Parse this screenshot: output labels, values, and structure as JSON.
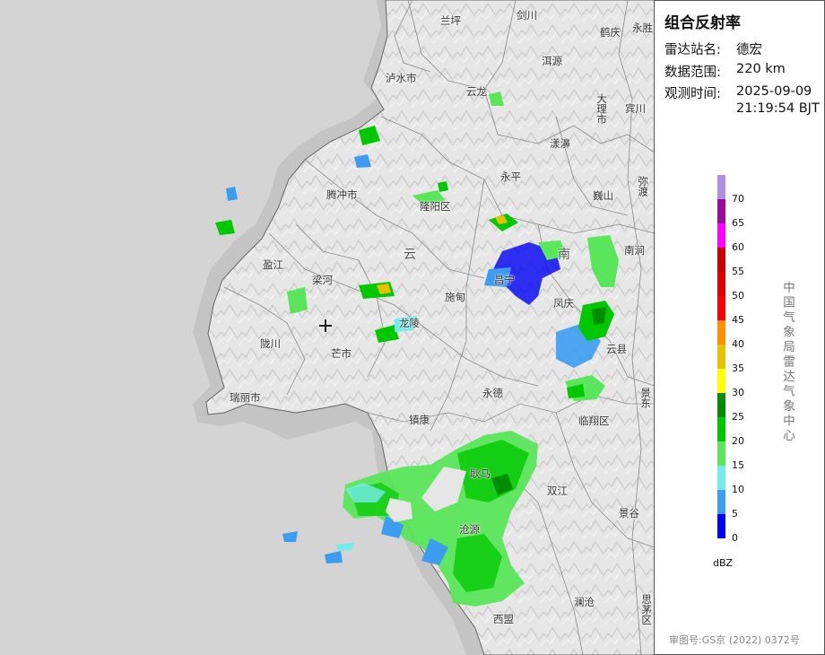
{
  "panel": {
    "title": "组合反射率",
    "station_label": "雷达站名:",
    "station_value": "德宏",
    "range_label": "数据范围:",
    "range_value": "220 km",
    "time_label": "观测时间:",
    "time_date": "2025-09-09",
    "time_clock": "21:19:54 BJT"
  },
  "legend": {
    "unit": "dBZ",
    "levels": [
      {
        "value": "70",
        "color": "#b18ee6"
      },
      {
        "value": "65",
        "color": "#9b0a9b"
      },
      {
        "value": "60",
        "color": "#ff00ff"
      },
      {
        "value": "55",
        "color": "#c80000"
      },
      {
        "value": "50",
        "color": "#e10000"
      },
      {
        "value": "45",
        "color": "#ff0000"
      },
      {
        "value": "40",
        "color": "#ff9000"
      },
      {
        "value": "35",
        "color": "#e7c000"
      },
      {
        "value": "30",
        "color": "#ffff00"
      },
      {
        "value": "25",
        "color": "#008e00"
      },
      {
        "value": "20",
        "color": "#00c800"
      },
      {
        "value": "15",
        "color": "#5ae65a"
      },
      {
        "value": "10",
        "color": "#74ecec"
      },
      {
        "value": "5",
        "color": "#3c9cf0"
      },
      {
        "value": "0",
        "color": "#0000f6"
      }
    ]
  },
  "organization": "中国气象局雷达气象中心",
  "approval": "审图号:GS京 (2022) 0372号",
  "map": {
    "cities": [
      {
        "name": "兰坪"
      },
      {
        "name": "剑川"
      },
      {
        "name": "鹤庆"
      },
      {
        "name": "永胜"
      },
      {
        "name": "洱源"
      },
      {
        "name": "泸水市"
      },
      {
        "name": "云龙"
      },
      {
        "name": "大理市"
      },
      {
        "name": "宾川"
      },
      {
        "name": "漾濞"
      },
      {
        "name": "腾冲市"
      },
      {
        "name": "隆阳区"
      },
      {
        "name": "永平"
      },
      {
        "name": "巍山"
      },
      {
        "name": "弥渡"
      },
      {
        "name": "云"
      },
      {
        "name": "南"
      },
      {
        "name": "南涧"
      },
      {
        "name": "盈江"
      },
      {
        "name": "梁河"
      },
      {
        "name": "施甸"
      },
      {
        "name": "昌宁"
      },
      {
        "name": "凤庆"
      },
      {
        "name": "龙陵"
      },
      {
        "name": "芒市"
      },
      {
        "name": "陇川"
      },
      {
        "name": "云县"
      },
      {
        "name": "瑞丽市"
      },
      {
        "name": "永德"
      },
      {
        "name": "景东"
      },
      {
        "name": "镇康"
      },
      {
        "name": "临翔区"
      },
      {
        "name": "耿马"
      },
      {
        "name": "双江"
      },
      {
        "name": "沧源"
      },
      {
        "name": "景谷"
      },
      {
        "name": "西盟"
      },
      {
        "name": "澜沧"
      },
      {
        "name": "思茅区"
      }
    ]
  }
}
